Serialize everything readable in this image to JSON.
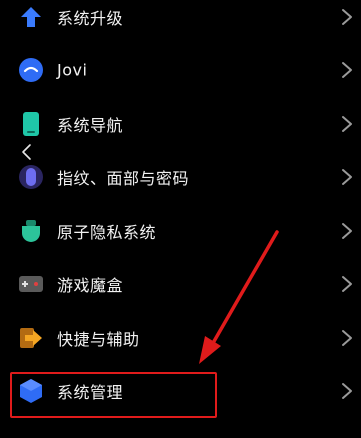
{
  "settings": {
    "items": [
      {
        "label": "系统升级",
        "icon": "upgrade-arrow-icon",
        "icon_color": "#3a7bfd"
      },
      {
        "label": "Jovi",
        "icon": "jovi-icon",
        "icon_color": "#2f6cf5"
      },
      {
        "label": "系统导航",
        "icon": "phone-navigation-icon",
        "icon_color": "#1fc7a8"
      },
      {
        "label": "指纹、面部与密码",
        "icon": "fingerprint-icon",
        "icon_color": "#5b5bd6"
      },
      {
        "label": "原子隐私系统",
        "icon": "atom-privacy-icon",
        "icon_color": "#2cc49a"
      },
      {
        "label": "游戏魔盒",
        "icon": "gamepad-icon",
        "icon_color": "#d9d9d9"
      },
      {
        "label": "快捷与辅助",
        "icon": "shortcut-arrow-icon",
        "icon_color": "#f5a623"
      },
      {
        "label": "系统管理",
        "icon": "hexagon-icon",
        "icon_color": "#2f6cf5"
      }
    ]
  },
  "colors": {
    "background": "#000000",
    "text": "#f2f2f2",
    "chevron": "#9a9a9a",
    "annotation": "#e01b1b"
  }
}
